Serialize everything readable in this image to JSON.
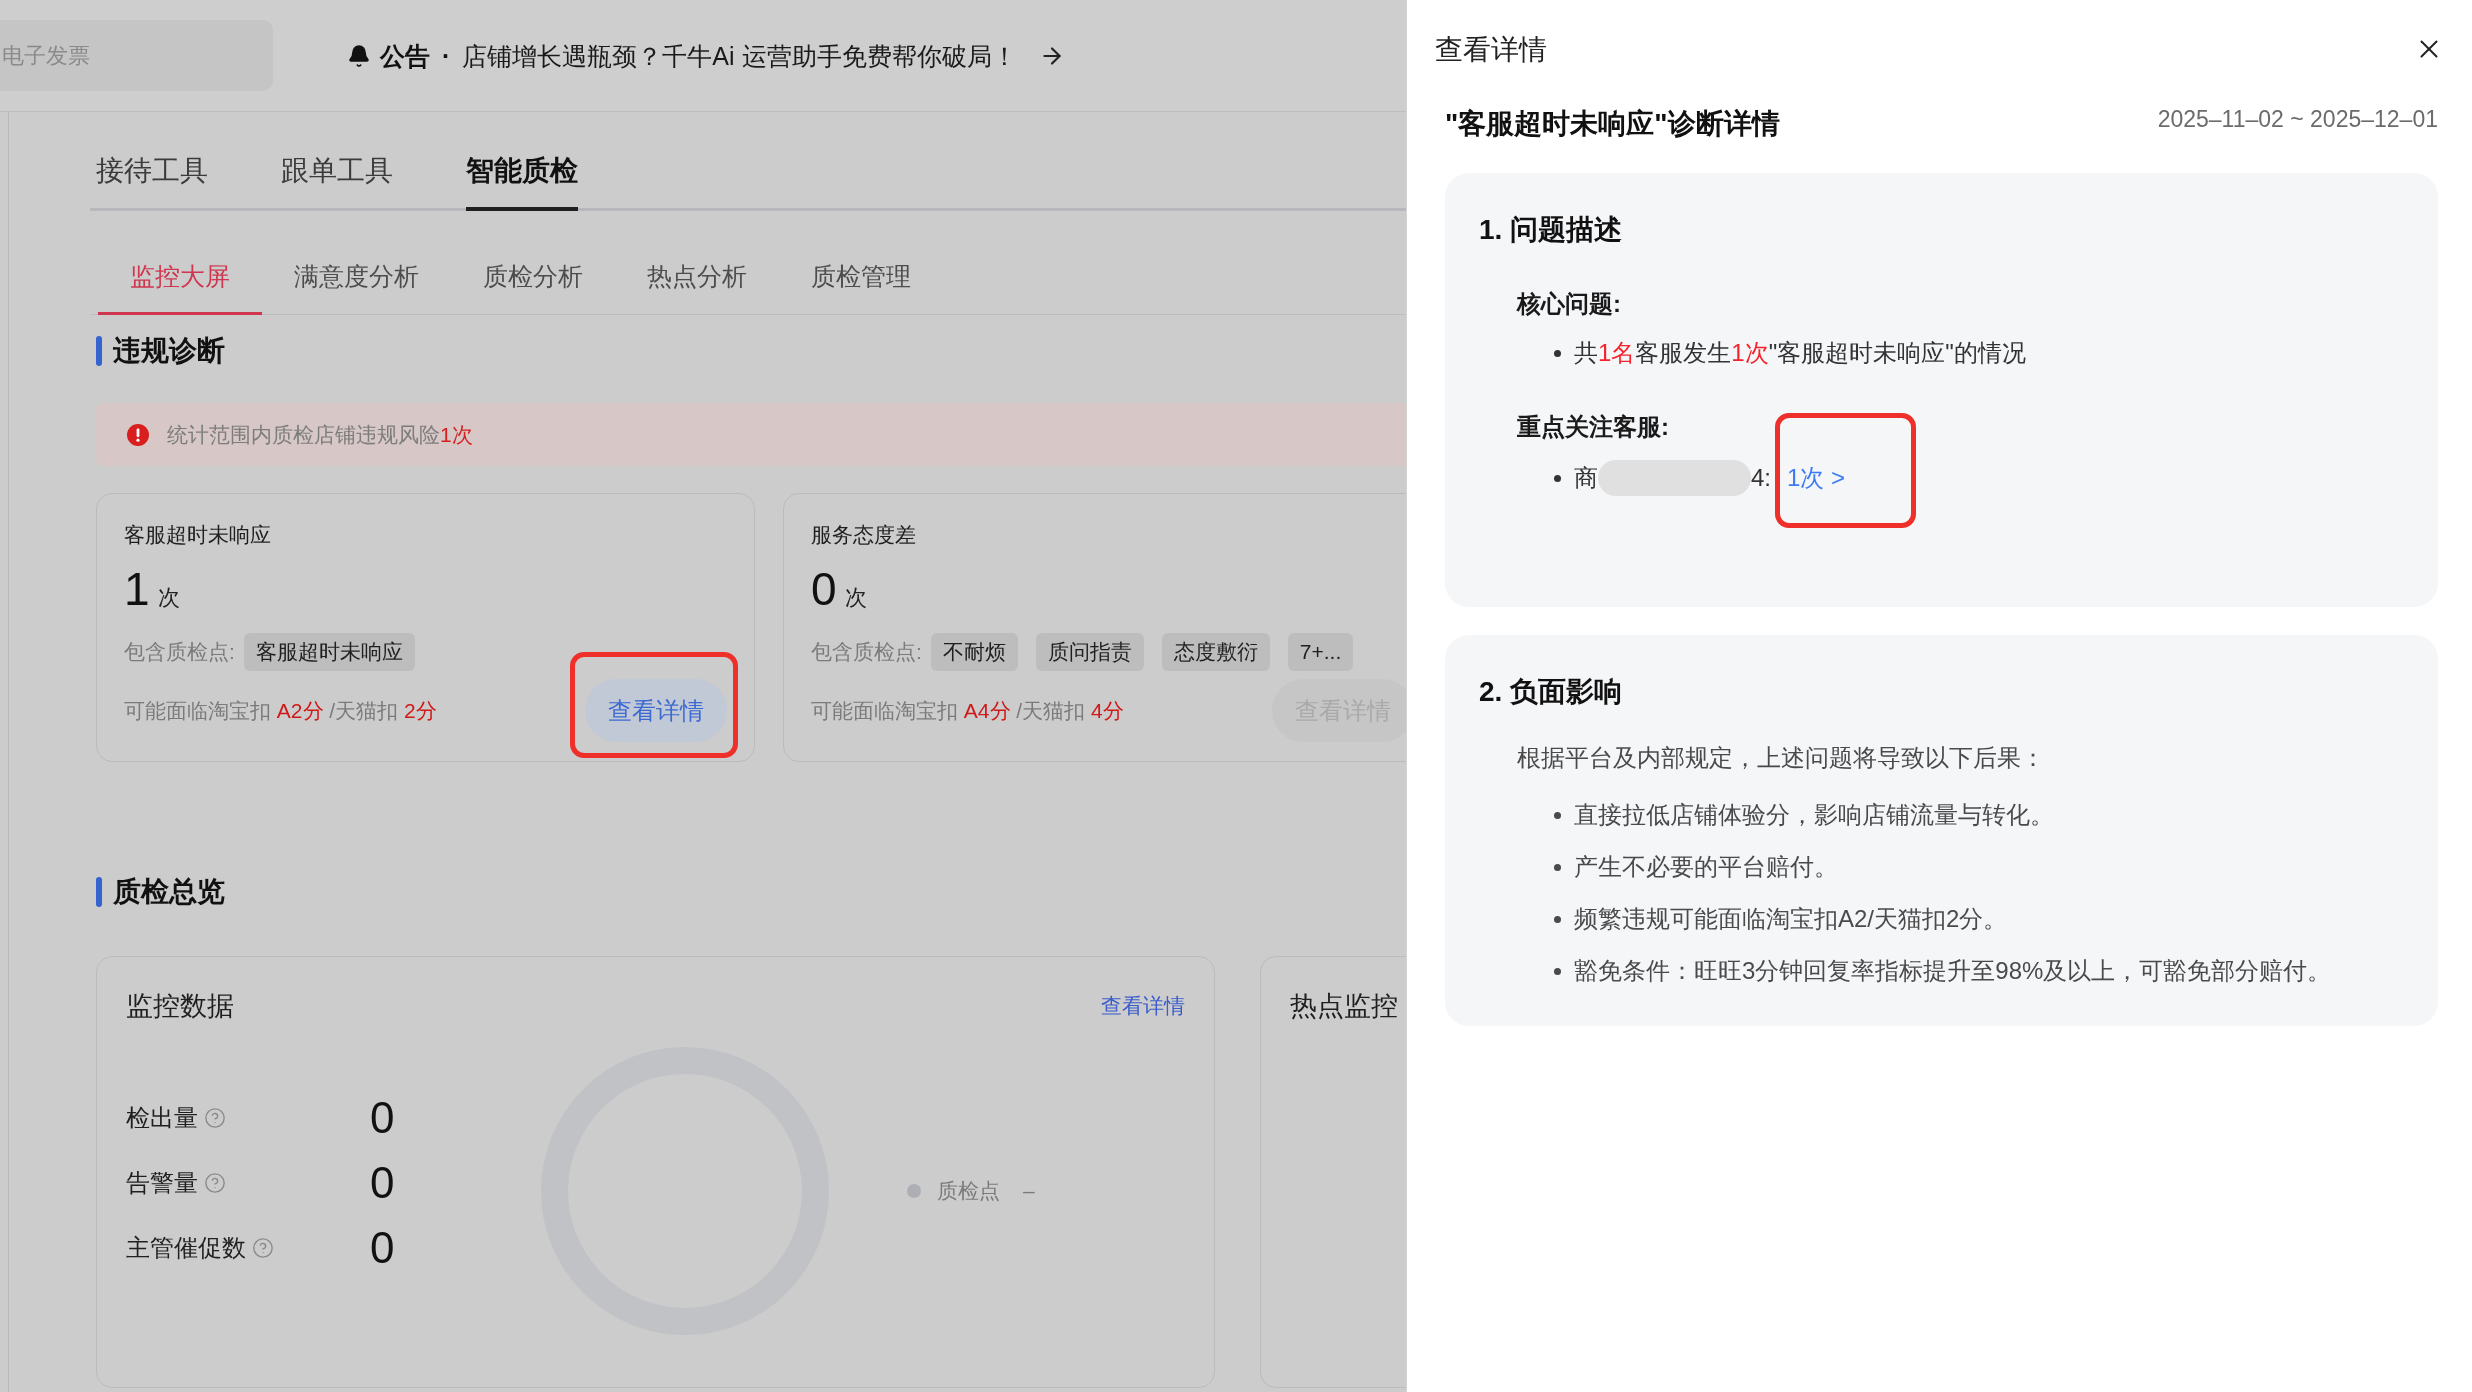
{
  "header": {
    "search": {
      "placeholder": "电子发票"
    },
    "announcement": {
      "label": "公告",
      "separator": "·",
      "text": "店铺增长遇瓶颈？千牛Ai 运营助手免费帮你破局！"
    }
  },
  "main_tabs": [
    {
      "label": "接待工具",
      "selected": false
    },
    {
      "label": "跟单工具",
      "selected": false
    },
    {
      "label": "智能质检",
      "selected": true
    }
  ],
  "sub_tabs": [
    {
      "label": "监控大屏",
      "selected": true
    },
    {
      "label": "满意度分析",
      "selected": false
    },
    {
      "label": "质检分析",
      "selected": false
    },
    {
      "label": "热点分析",
      "selected": false
    },
    {
      "label": "质检管理",
      "selected": false
    }
  ],
  "violation_section": {
    "title": "违规诊断",
    "alert": {
      "segments": [
        {
          "text": "统计范围内质检店铺违规风险",
          "emphasis": false
        },
        {
          "text": "1次",
          "emphasis": true
        }
      ]
    },
    "cards": [
      {
        "title": "客服超时未响应",
        "count": "1",
        "unit": "次",
        "checkpoints_label": "包含质检点:",
        "checkpoints": [
          "客服超时未响应"
        ],
        "penalty": [
          {
            "text": "可能面临淘宝扣 ",
            "emphasis": false
          },
          {
            "text": "A2分",
            "emphasis": true
          },
          {
            "text": " /天猫扣 ",
            "emphasis": false
          },
          {
            "text": "2分",
            "emphasis": true
          }
        ],
        "button": {
          "label": "查看详情",
          "disabled": false,
          "highlighted": true
        }
      },
      {
        "title": "服务态度差",
        "count": "0",
        "unit": "次",
        "checkpoints_label": "包含质检点:",
        "checkpoints": [
          "不耐烦",
          "质问指责",
          "态度敷衍",
          "7+..."
        ],
        "penalty": [
          {
            "text": "可能面临淘宝扣 ",
            "emphasis": false
          },
          {
            "text": "A4分",
            "emphasis": true
          },
          {
            "text": " /天猫扣 ",
            "emphasis": false
          },
          {
            "text": "4分",
            "emphasis": true
          }
        ],
        "button": {
          "label": "查看详情",
          "disabled": true,
          "highlighted": false
        }
      }
    ]
  },
  "overview_section": {
    "title": "质检总览",
    "monitor_card": {
      "title": "监控数据",
      "link": "查看详情",
      "metrics": [
        {
          "label": "检出量",
          "value": "0"
        },
        {
          "label": "告警量",
          "value": "0"
        },
        {
          "label": "主管催促数",
          "value": "0"
        }
      ],
      "legend": [
        {
          "label": "质检点",
          "value": "–"
        }
      ]
    },
    "hotspot_card": {
      "title": "热点监控"
    }
  },
  "drawer": {
    "title": "查看详情",
    "heading": "\"客服超时未响应\"诊断详情",
    "date_range": "2025–11–02 ~ 2025–12–01",
    "sections": [
      {
        "kind": "description",
        "title": "1. 问题描述",
        "groups": [
          {
            "kind": "issues",
            "label": "核心问题:",
            "items": [
              {
                "segments": [
                  {
                    "text": "共",
                    "emphasis": false
                  },
                  {
                    "text": "1名",
                    "emphasis": true
                  },
                  {
                    "text": "客服发生",
                    "emphasis": false
                  },
                  {
                    "text": "1次",
                    "emphasis": true
                  },
                  {
                    "text": "\"客服超时未响应\"的情况",
                    "emphasis": false
                  }
                ]
              }
            ]
          },
          {
            "kind": "agents",
            "label": "重点关注客服:",
            "items": [
              {
                "name_start": "商",
                "redacted": true,
                "name_end": "4:",
                "count": "1次 >",
                "highlighted": true
              }
            ]
          }
        ]
      },
      {
        "kind": "impact",
        "title": "2. 负面影响",
        "intro": "根据平台及内部规定，上述问题将导致以下后果：",
        "items": [
          "直接拉低店铺体验分，影响店铺流量与转化。",
          "产生不必要的平台赔付。",
          "频繁违规可能面临淘宝扣A2/天猫扣2分。",
          "豁免条件：旺旺3分钟回复率指标提升至98%及以上，可豁免部分赔付。"
        ]
      }
    ]
  }
}
